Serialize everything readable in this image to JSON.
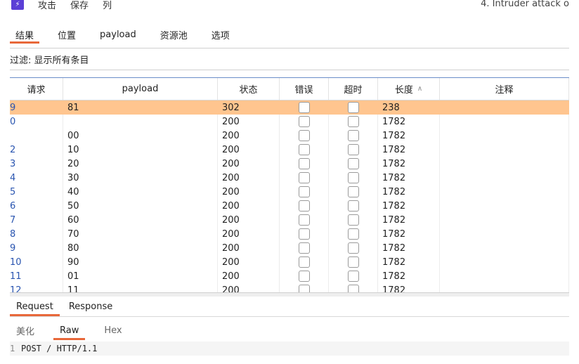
{
  "menubar": {
    "app_icon": "burp-icon",
    "items": [
      "攻击",
      "保存",
      "列"
    ],
    "window_title": "4. Intruder attack o"
  },
  "tabs": [
    {
      "label": "结果",
      "active": true
    },
    {
      "label": "位置",
      "active": false
    },
    {
      "label": "payload",
      "active": false
    },
    {
      "label": "资源池",
      "active": false
    },
    {
      "label": "选项",
      "active": false
    }
  ],
  "filter": {
    "text": "过滤: 显示所有条目"
  },
  "table": {
    "columns": [
      "请求",
      "payload",
      "状态",
      "错误",
      "超时",
      "长度",
      "注释"
    ],
    "sort_indicator": "^",
    "rows": [
      {
        "request": "9",
        "payload": "81",
        "status": "302",
        "length": "238",
        "selected": true
      },
      {
        "request": "0",
        "payload": "",
        "status": "200",
        "length": "1782"
      },
      {
        "request": "",
        "payload": "00",
        "status": "200",
        "length": "1782"
      },
      {
        "request": "2",
        "payload": "10",
        "status": "200",
        "length": "1782"
      },
      {
        "request": "3",
        "payload": "20",
        "status": "200",
        "length": "1782"
      },
      {
        "request": "4",
        "payload": "30",
        "status": "200",
        "length": "1782"
      },
      {
        "request": "5",
        "payload": "40",
        "status": "200",
        "length": "1782"
      },
      {
        "request": "6",
        "payload": "50",
        "status": "200",
        "length": "1782"
      },
      {
        "request": "7",
        "payload": "60",
        "status": "200",
        "length": "1782"
      },
      {
        "request": "8",
        "payload": "70",
        "status": "200",
        "length": "1782"
      },
      {
        "request": "9",
        "payload": "80",
        "status": "200",
        "length": "1782"
      },
      {
        "request": "10",
        "payload": "90",
        "status": "200",
        "length": "1782"
      },
      {
        "request": "11",
        "payload": "01",
        "status": "200",
        "length": "1782"
      },
      {
        "request": "12",
        "payload": "11",
        "status": "200",
        "length": "1782"
      }
    ]
  },
  "subtabs": [
    {
      "label": "Request",
      "active": true
    },
    {
      "label": "Response",
      "active": false
    }
  ],
  "viewtabs": [
    {
      "label": "美化",
      "active": false
    },
    {
      "label": "Raw",
      "active": true
    },
    {
      "label": "Hex",
      "active": false
    }
  ],
  "editor": {
    "line_number": "1",
    "line_text": "POST / HTTP/1.1"
  },
  "colors": {
    "accent": "#e8683a",
    "selected_row": "#ffc58f",
    "header_border": "#6a8ec9"
  }
}
